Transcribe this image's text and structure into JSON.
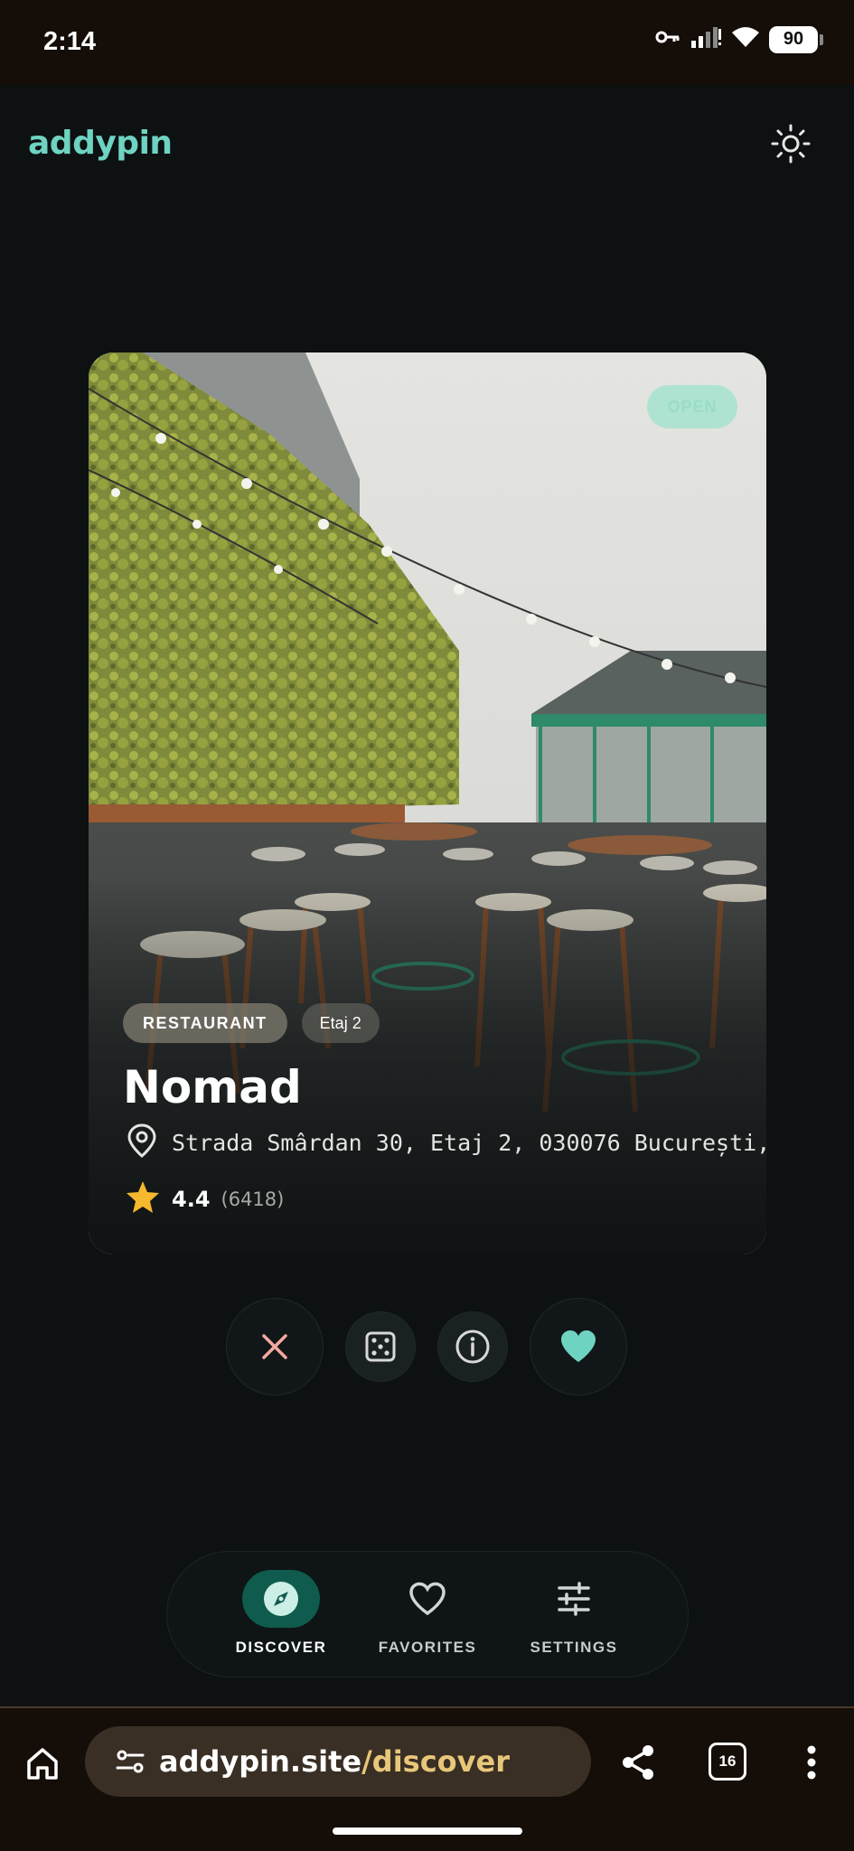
{
  "status_bar": {
    "time": "2:14",
    "battery": "90",
    "icons": [
      "key-icon",
      "signal-icon",
      "wifi-icon",
      "battery-icon"
    ]
  },
  "header": {
    "logo": "addypin",
    "theme_toggle_icon": "sun-icon"
  },
  "card": {
    "status_badge": "OPEN",
    "category": "RESTAURANT",
    "floor_tag": "Etaj 2",
    "name": "Nomad",
    "address": "Strada Smârdan 30, Etaj 2, 030076 București,",
    "rating": "4.4",
    "rating_count": "(6418)",
    "photo_description_icon": "photo-rooftop-terrace"
  },
  "actions": {
    "dismiss_icon": "close-icon",
    "random_icon": "dice-icon",
    "info_icon": "info-icon",
    "favorite_icon": "heart-icon"
  },
  "bottom_nav": {
    "items": [
      {
        "label": "DISCOVER",
        "icon": "compass-icon",
        "active": true
      },
      {
        "label": "FAVORITES",
        "icon": "heart-outline-icon",
        "active": false
      },
      {
        "label": "SETTINGS",
        "icon": "sliders-icon",
        "active": false
      }
    ]
  },
  "browser": {
    "url_host": "addypin.site",
    "url_path": "/discover",
    "tab_count": "16"
  },
  "colors": {
    "accent": "#6fd3c1",
    "background": "#0d1112",
    "nav_active": "#0f5b4d",
    "star": "#f5b82e",
    "url_path": "#e8c77a"
  }
}
